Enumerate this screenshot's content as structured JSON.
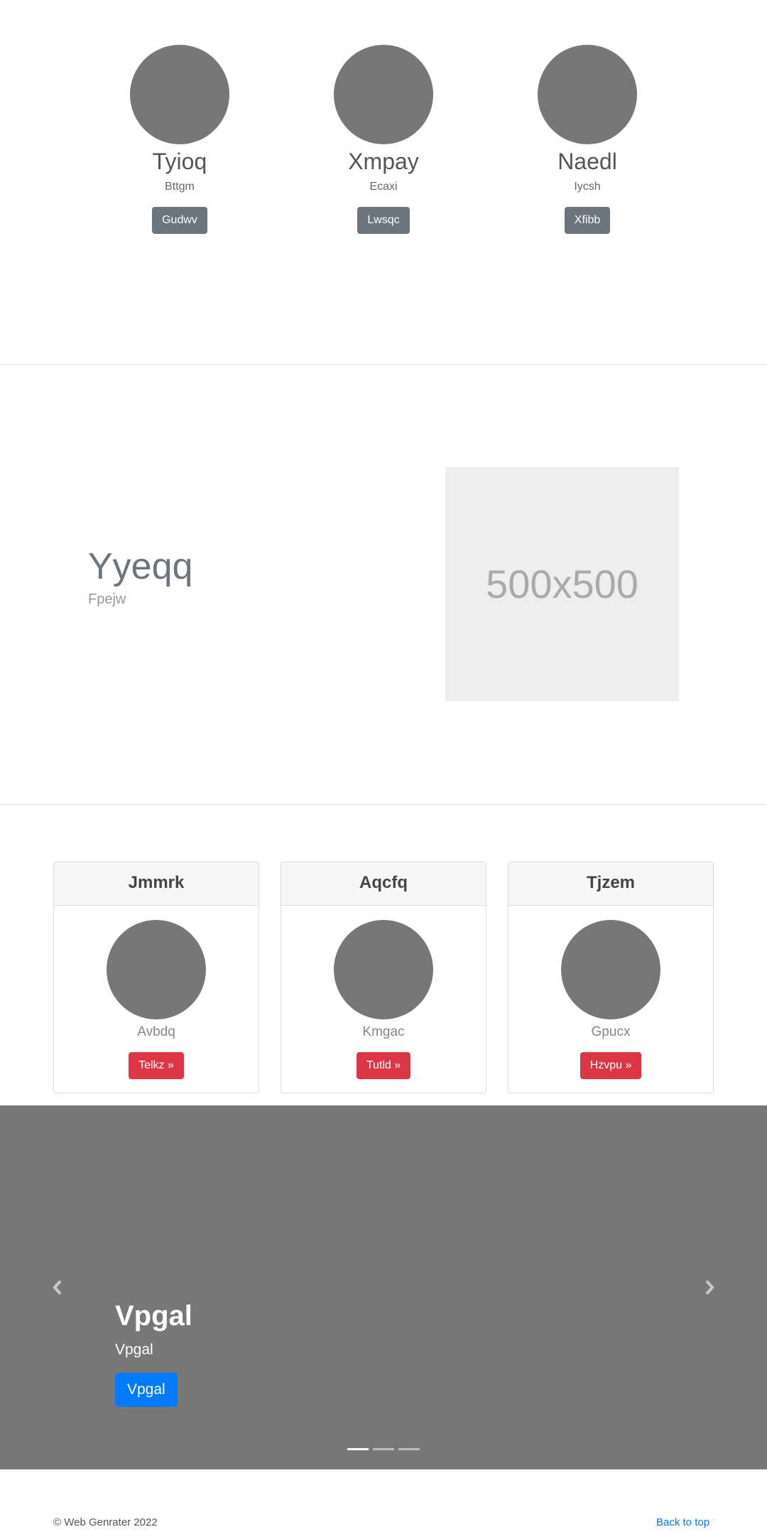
{
  "team": {
    "members": [
      {
        "name": "Tyioq",
        "role": "Bttgm",
        "button": "Gudwv"
      },
      {
        "name": "Xmpay",
        "role": "Ecaxi",
        "button": "Lwsqc"
      },
      {
        "name": "Naedl",
        "role": "Iycsh",
        "button": "Xfibb"
      }
    ]
  },
  "feature": {
    "title": "Yyeqq",
    "subtitle": "Fpejw",
    "placeholder_label": "500x500"
  },
  "cards": [
    {
      "header": "Jmmrk",
      "text": "Avbdq",
      "button": "Telkz »"
    },
    {
      "header": "Aqcfq",
      "text": "Kmgac",
      "button": "Tutld »"
    },
    {
      "header": "Tjzem",
      "text": "Gpucx",
      "button": "Hzvpu »"
    }
  ],
  "carousel": {
    "title": "Vpgal",
    "subtitle": "Vpgal",
    "button": "Vpgal",
    "prev_icon": "chevron-left-icon",
    "next_icon": "chevron-right-icon",
    "slides_count": 3,
    "active_slide": 1
  },
  "footer": {
    "copyright": "© Web Genrater 2022",
    "back_to_top": "Back to top"
  },
  "colors": {
    "secondary": "#6c757d",
    "danger": "#dc3545",
    "primary": "#007bff",
    "placeholder_gray": "#777777"
  }
}
